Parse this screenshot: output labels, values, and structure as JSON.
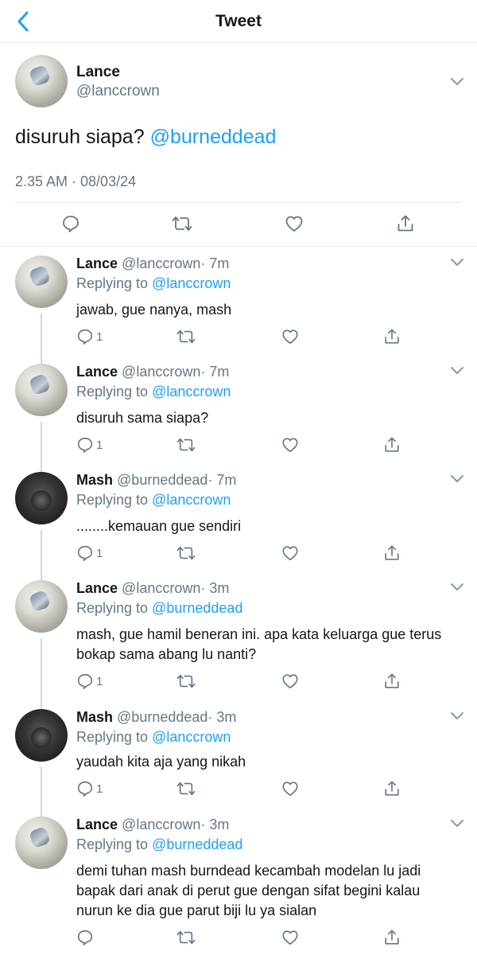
{
  "header": {
    "title": "Tweet",
    "back_icon": "chevron-left-icon",
    "accent": "#1da1f2"
  },
  "main_tweet": {
    "name": "Lance",
    "handle": "@lanccrown",
    "text": "disuruh siapa? ",
    "mention": "@burneddead",
    "timestamp": "2.35 AM · 08/03/24"
  },
  "replies": [
    {
      "name": "Lance",
      "handle": "@lanccrown",
      "time": "· 7m",
      "replying_label": "Replying to ",
      "replying_to": "@lanccrown",
      "text": "jawab, gue nanya, mash",
      "reply_count": "1",
      "avatar": "lance"
    },
    {
      "name": "Lance",
      "handle": "@lanccrown",
      "time": "· 7m",
      "replying_label": "Replying to ",
      "replying_to": "@lanccrown",
      "text": "disuruh sama siapa?",
      "reply_count": "1",
      "avatar": "lance"
    },
    {
      "name": "Mash",
      "handle": "@burneddead",
      "time": "· 7m",
      "replying_label": "Replying to ",
      "replying_to": "@lanccrown",
      "text": "........kemauan gue sendiri",
      "reply_count": "1",
      "avatar": "mash"
    },
    {
      "name": "Lance",
      "handle": "@lanccrown",
      "time": "· 3m",
      "replying_label": "Replying to ",
      "replying_to": "@burneddead",
      "text": "mash, gue hamil beneran ini. apa kata keluarga gue terus bokap sama abang lu nanti?",
      "reply_count": "1",
      "avatar": "lance"
    },
    {
      "name": "Mash",
      "handle": "@burneddead",
      "time": "· 3m",
      "replying_label": "Replying to ",
      "replying_to": "@lanccrown",
      "text": "yaudah kita aja yang nikah",
      "reply_count": "1",
      "avatar": "mash"
    },
    {
      "name": "Lance",
      "handle": "@lanccrown",
      "time": "· 3m",
      "replying_label": "Replying to ",
      "replying_to": "@burneddead",
      "text": "demi tuhan mash burndead kecambah modelan lu jadi bapak dari anak di perut gue dengan sifat begini kalau nurun ke dia gue parut biji lu ya sialan",
      "reply_count": "",
      "avatar": "lance"
    }
  ]
}
